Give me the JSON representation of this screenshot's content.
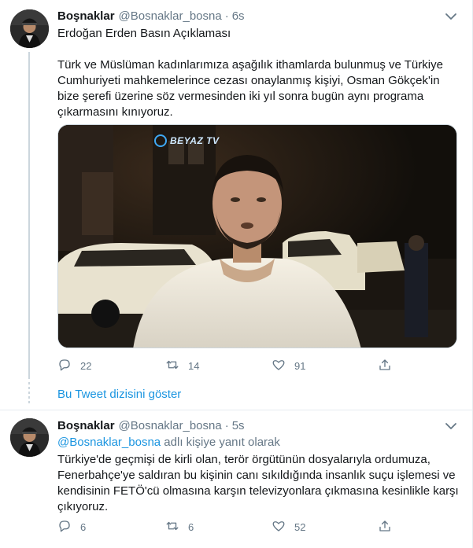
{
  "tweet1": {
    "display_name": "Boşnaklar",
    "handle": "@Bosnaklar_bosna",
    "separator": "·",
    "time": "6s",
    "title_line": "Erdoğan Erden Basın Açıklaması",
    "body": "Türk ve Müslüman kadınlarımıza aşağılık ithamlarda bulunmuş ve Türkiye Cumhuriyeti mahkemelerince cezası onaylanmış kişiyi, Osman Gökçek'in bize şerefi üzerine söz vermesinden iki yıl sonra bugün aynı programa çıkarmasını kınıyoruz.",
    "media_watermark": "BEYAZ TV",
    "replies": "22",
    "retweets": "14",
    "likes": "91"
  },
  "show_thread": {
    "label": "Bu Tweet dizisini göster"
  },
  "tweet2": {
    "display_name": "Boşnaklar",
    "handle": "@Bosnaklar_bosna",
    "separator": "·",
    "time": "5s",
    "reply_handle": "@Bosnaklar_bosna",
    "reply_suffix": " adlı kişiye yanıt olarak",
    "body": "Türkiye'de geçmişi de kirli olan, terör örgütünün dosyalarıyla ordumuza, Fenerbahçe'ye saldıran bu kişinin canı sıkıldığında insanlık suçu işlemesi ve kendisinin FETÖ'cü olmasına karşın televizyonlara çıkmasına kesinlikle karşı çıkıyoruz.",
    "replies": "6",
    "retweets": "6",
    "likes": "52"
  },
  "colors": {
    "link": "#1b95e0",
    "secondary": "#657786",
    "text": "#14171a",
    "border": "#e6ecf0"
  },
  "icons": [
    "avatar",
    "caret-down-icon",
    "reply-icon",
    "retweet-icon",
    "like-icon",
    "share-icon"
  ]
}
